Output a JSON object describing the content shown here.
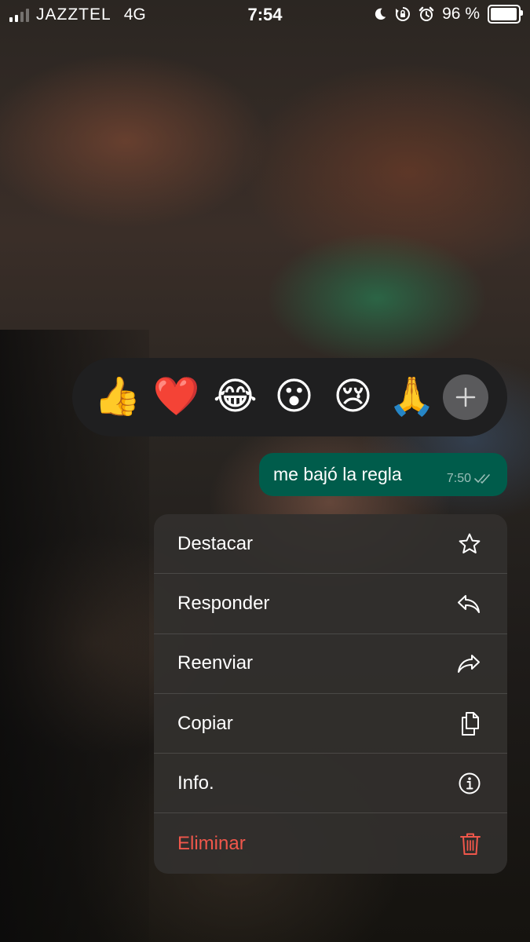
{
  "status_bar": {
    "carrier": "JAZZTEL",
    "network": "4G",
    "time": "7:54",
    "battery": "96 %",
    "battery_level": 0.96,
    "icons": [
      "moon-icon",
      "rotation-lock-icon",
      "alarm-icon",
      "battery-icon"
    ]
  },
  "reactions": {
    "items": [
      {
        "name": "thumbs-up",
        "emoji": "👍"
      },
      {
        "name": "red-heart",
        "emoji": "❤️"
      },
      {
        "name": "tears-of-joy",
        "emoji": "😂"
      },
      {
        "name": "surprised-face",
        "emoji": "😮"
      },
      {
        "name": "crying-face",
        "emoji": "😢"
      },
      {
        "name": "folded-hands",
        "emoji": "🙏"
      }
    ],
    "more_icon": "plus-icon"
  },
  "message": {
    "text": "me bajó la regla",
    "time": "7:50",
    "status_icon": "double-check-icon"
  },
  "menu": {
    "items": [
      {
        "label": "Destacar",
        "icon": "star-icon"
      },
      {
        "label": "Responder",
        "icon": "reply-icon"
      },
      {
        "label": "Reenviar",
        "icon": "forward-icon"
      },
      {
        "label": "Copiar",
        "icon": "copy-icon"
      },
      {
        "label": "Info.",
        "icon": "info-icon"
      },
      {
        "label": "Eliminar",
        "icon": "trash-icon",
        "destructive": true
      }
    ]
  },
  "colors": {
    "bubble": "#005c4b",
    "reaction_bar": "#1f1f20",
    "menu": "#32302e",
    "destructive": "#f0574b"
  }
}
